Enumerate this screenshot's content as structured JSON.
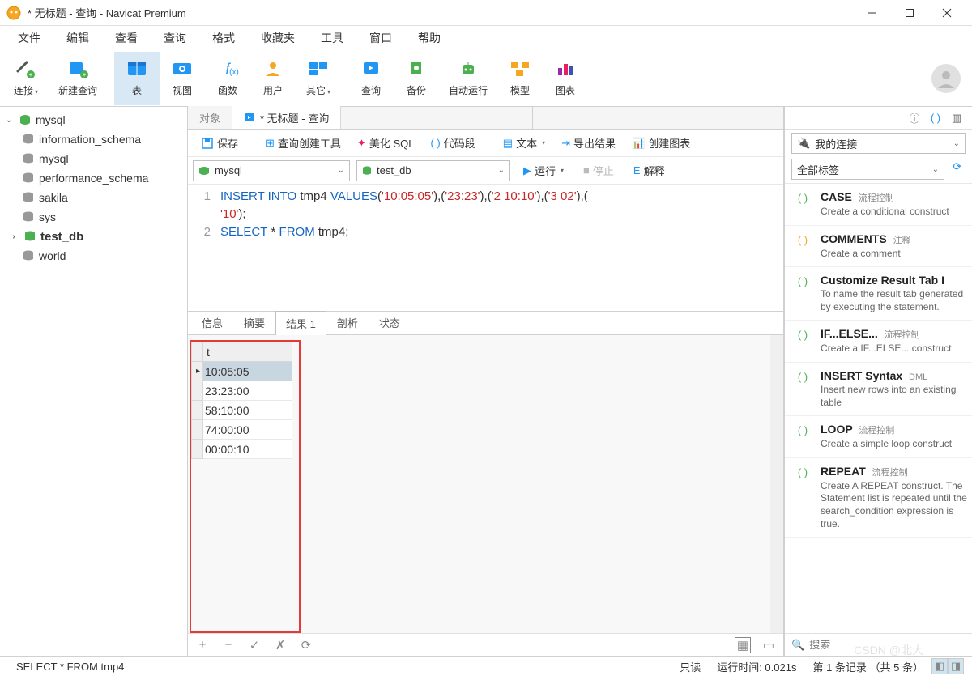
{
  "window": {
    "title": "* 无标题 - 查询 - Navicat Premium"
  },
  "menu": [
    "文件",
    "编辑",
    "查看",
    "查询",
    "格式",
    "收藏夹",
    "工具",
    "窗口",
    "帮助"
  ],
  "toolbar": [
    {
      "label": "连接",
      "chev": true
    },
    {
      "label": "新建查询"
    },
    {
      "label": "表",
      "active": true
    },
    {
      "label": "视图"
    },
    {
      "label": "函数"
    },
    {
      "label": "用户"
    },
    {
      "label": "其它",
      "chev": true
    },
    {
      "label": "查询"
    },
    {
      "label": "备份"
    },
    {
      "label": "自动运行"
    },
    {
      "label": "模型"
    },
    {
      "label": "图表"
    }
  ],
  "tree": {
    "root": "mysql",
    "children": [
      "information_schema",
      "mysql",
      "performance_schema",
      "sakila",
      "sys",
      {
        "name": "test_db",
        "bold": true,
        "expandable": true
      },
      "world"
    ]
  },
  "tabs": {
    "objects": "对象",
    "query": "* 无标题 - 查询"
  },
  "queryToolbar": {
    "save": "保存",
    "builder": "查询创建工具",
    "beautify": "美化 SQL",
    "snippets": "代码段",
    "text": "文本",
    "export": "导出结果",
    "chart": "创建图表"
  },
  "connRow": {
    "connection": "mysql",
    "database": "test_db",
    "run": "运行",
    "stop": "停止",
    "explain": "解释"
  },
  "sql": {
    "line1_insert": "INSERT INTO",
    "line1_table": " tmp4 ",
    "line1_values": "VALUES",
    "line1_rest": "('10:05:05'),('23:23'),('2 10:10'),('3 02'),('10');",
    "line2_select": "SELECT",
    "line2_rest": " * ",
    "line2_from": "FROM",
    "line2_table": " tmp4;"
  },
  "resultTabs": [
    "信息",
    "摘要",
    "结果 1",
    "剖析",
    "状态"
  ],
  "grid": {
    "header": "t",
    "rows": [
      "10:05:05",
      "23:23:00",
      "58:10:00",
      "74:00:00",
      "00:00:10"
    ]
  },
  "rightPanel": {
    "connFilter": "我的连接",
    "tagFilter": "全部标签",
    "searchPlaceholder": "搜索",
    "snippets": [
      {
        "title": "CASE",
        "sub": "流程控制",
        "desc": "Create a conditional construct"
      },
      {
        "title": "COMMENTS",
        "sub": "注释",
        "desc": "Create a comment"
      },
      {
        "title": "Customize Result Tab I",
        "sub": "",
        "desc": "To name the result tab generated by executing the statement."
      },
      {
        "title": "IF...ELSE...",
        "sub": "流程控制",
        "desc": "Create a IF...ELSE... construct"
      },
      {
        "title": "INSERT Syntax",
        "sub": "DML",
        "desc": "Insert new rows into an existing table"
      },
      {
        "title": "LOOP",
        "sub": "流程控制",
        "desc": "Create a simple loop construct"
      },
      {
        "title": "REPEAT",
        "sub": "流程控制",
        "desc": "Create A REPEAT construct. The Statement list is repeated until the search_condition expression is true."
      }
    ]
  },
  "statusbar": {
    "query": "SELECT * FROM tmp4",
    "mode": "只读",
    "time": "运行时间: 0.021s",
    "records": "第 1 条记录 （共 5 条）"
  },
  "watermark": "CSDN @北大"
}
